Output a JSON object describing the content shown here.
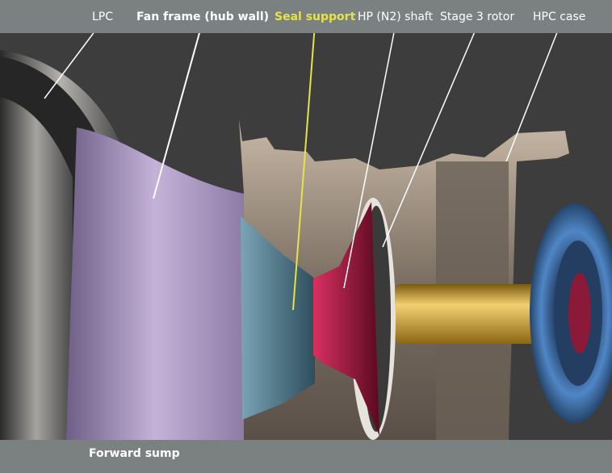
{
  "labels": {
    "lpc": "LPC",
    "fan_frame": "Fan frame (hub wall)",
    "seal_support": "Seal support",
    "hp_shaft": "HP (N2) shaft",
    "stage3_rotor": "Stage 3 rotor",
    "hpc_case": "HPC case"
  },
  "footer": {
    "forward_sump": "Forward sump"
  },
  "colors": {
    "bar": "#7b8180",
    "background": "#3d3d3d",
    "highlight": "#e6e24a",
    "fan_frame": "#a08eb8",
    "seal_support": "#4a7a90",
    "hp_rotor": "#a01840",
    "shaft": "#d4a830",
    "case": "#8a7e70",
    "hpc_ring": "#3a6aa8"
  }
}
